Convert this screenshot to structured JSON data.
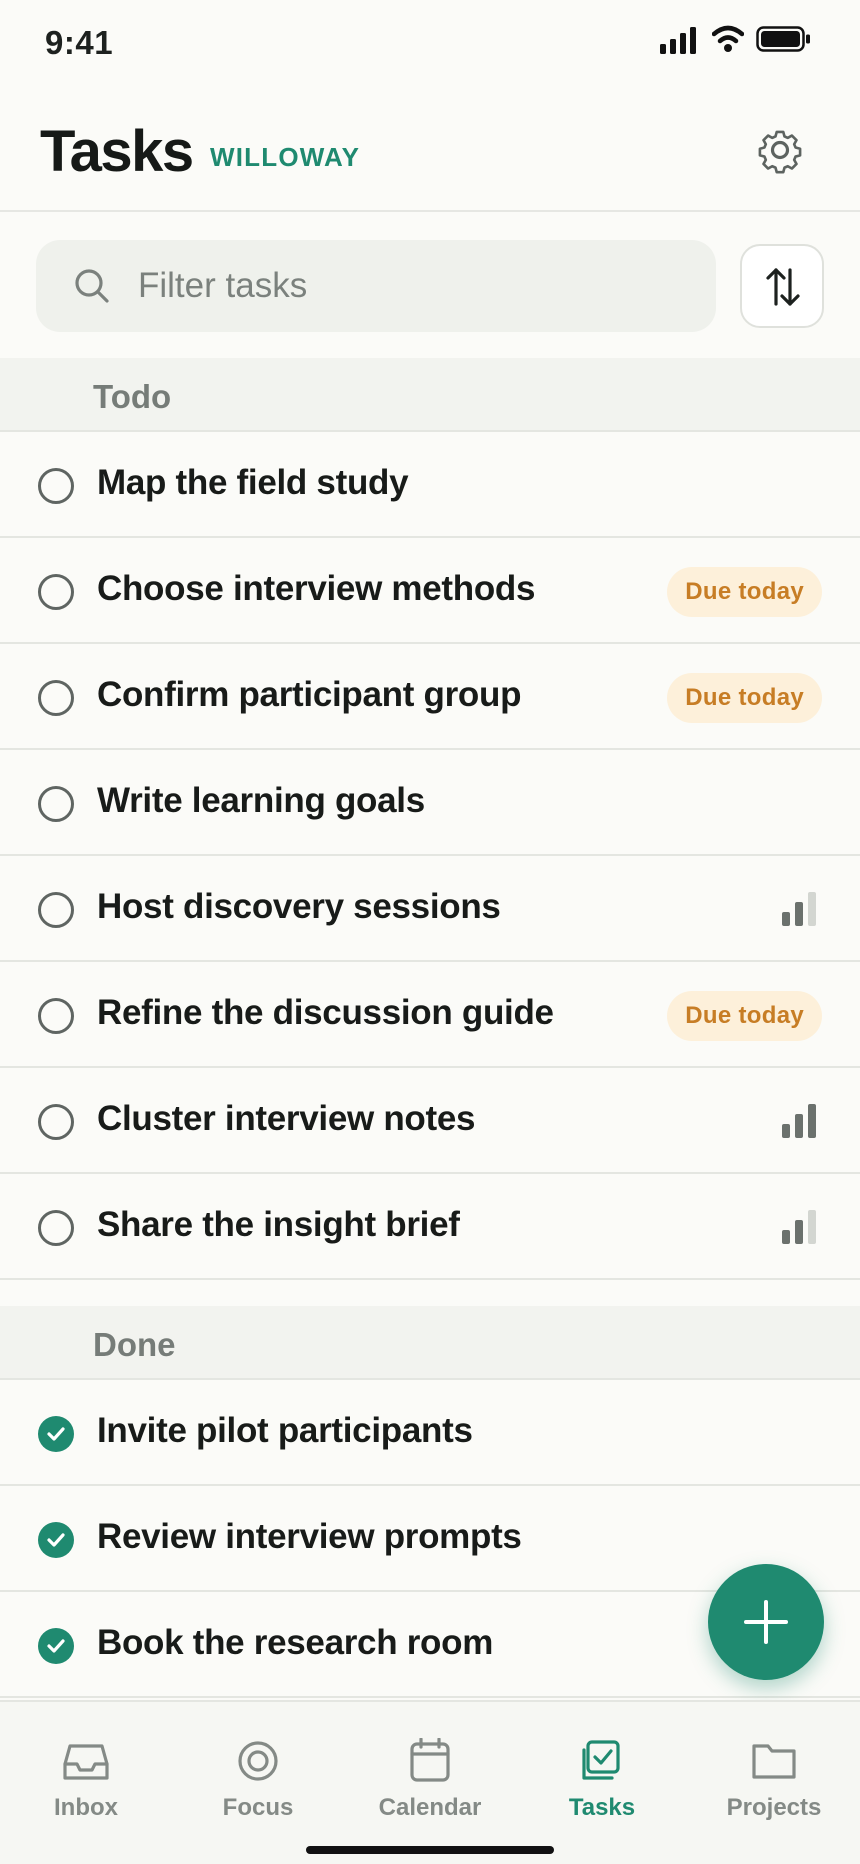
{
  "status_bar": {
    "time": "9:41",
    "icons": [
      "signal-icon",
      "wifi-icon",
      "battery-icon"
    ]
  },
  "header": {
    "title": "Tasks",
    "workspace": "WILLOWAY",
    "settings_icon": "gear-icon"
  },
  "search": {
    "placeholder": "Filter tasks",
    "value": "",
    "icon": "search-icon"
  },
  "sort_button": {
    "icon": "sort-arrows-icon"
  },
  "sections": {
    "todo": {
      "title": "Todo",
      "tasks": [
        {
          "title": "Map the field study",
          "badge": "",
          "priority": 0
        },
        {
          "title": "Choose interview methods",
          "badge": "Due today",
          "priority": 0
        },
        {
          "title": "Confirm participant group",
          "badge": "Due today",
          "priority": 0
        },
        {
          "title": "Write learning goals",
          "badge": "",
          "priority": 0
        },
        {
          "title": "Host discovery sessions",
          "badge": "",
          "priority": 2
        },
        {
          "title": "Refine the discussion guide",
          "badge": "Due today",
          "priority": 0
        },
        {
          "title": "Cluster interview notes",
          "badge": "",
          "priority": 3
        },
        {
          "title": "Share the insight brief",
          "badge": "",
          "priority": 2
        }
      ]
    },
    "done": {
      "title": "Done",
      "tasks": [
        {
          "title": "Invite pilot participants"
        },
        {
          "title": "Review interview prompts"
        },
        {
          "title": "Book the research room"
        }
      ]
    }
  },
  "fab": {
    "icon": "plus-icon"
  },
  "nav": {
    "items": [
      {
        "label": "Inbox",
        "icon": "inbox-icon",
        "active": false
      },
      {
        "label": "Focus",
        "icon": "target-icon",
        "active": false
      },
      {
        "label": "Calendar",
        "icon": "calendar-icon",
        "active": false
      },
      {
        "label": "Tasks",
        "icon": "checkbox-icon",
        "active": true
      },
      {
        "label": "Projects",
        "icon": "folder-icon",
        "active": false
      }
    ]
  },
  "colors": {
    "accent": "#1f8a70",
    "badge_bg": "#fdf0da",
    "badge_text": "#c77d25",
    "background": "#fbfbf8"
  }
}
